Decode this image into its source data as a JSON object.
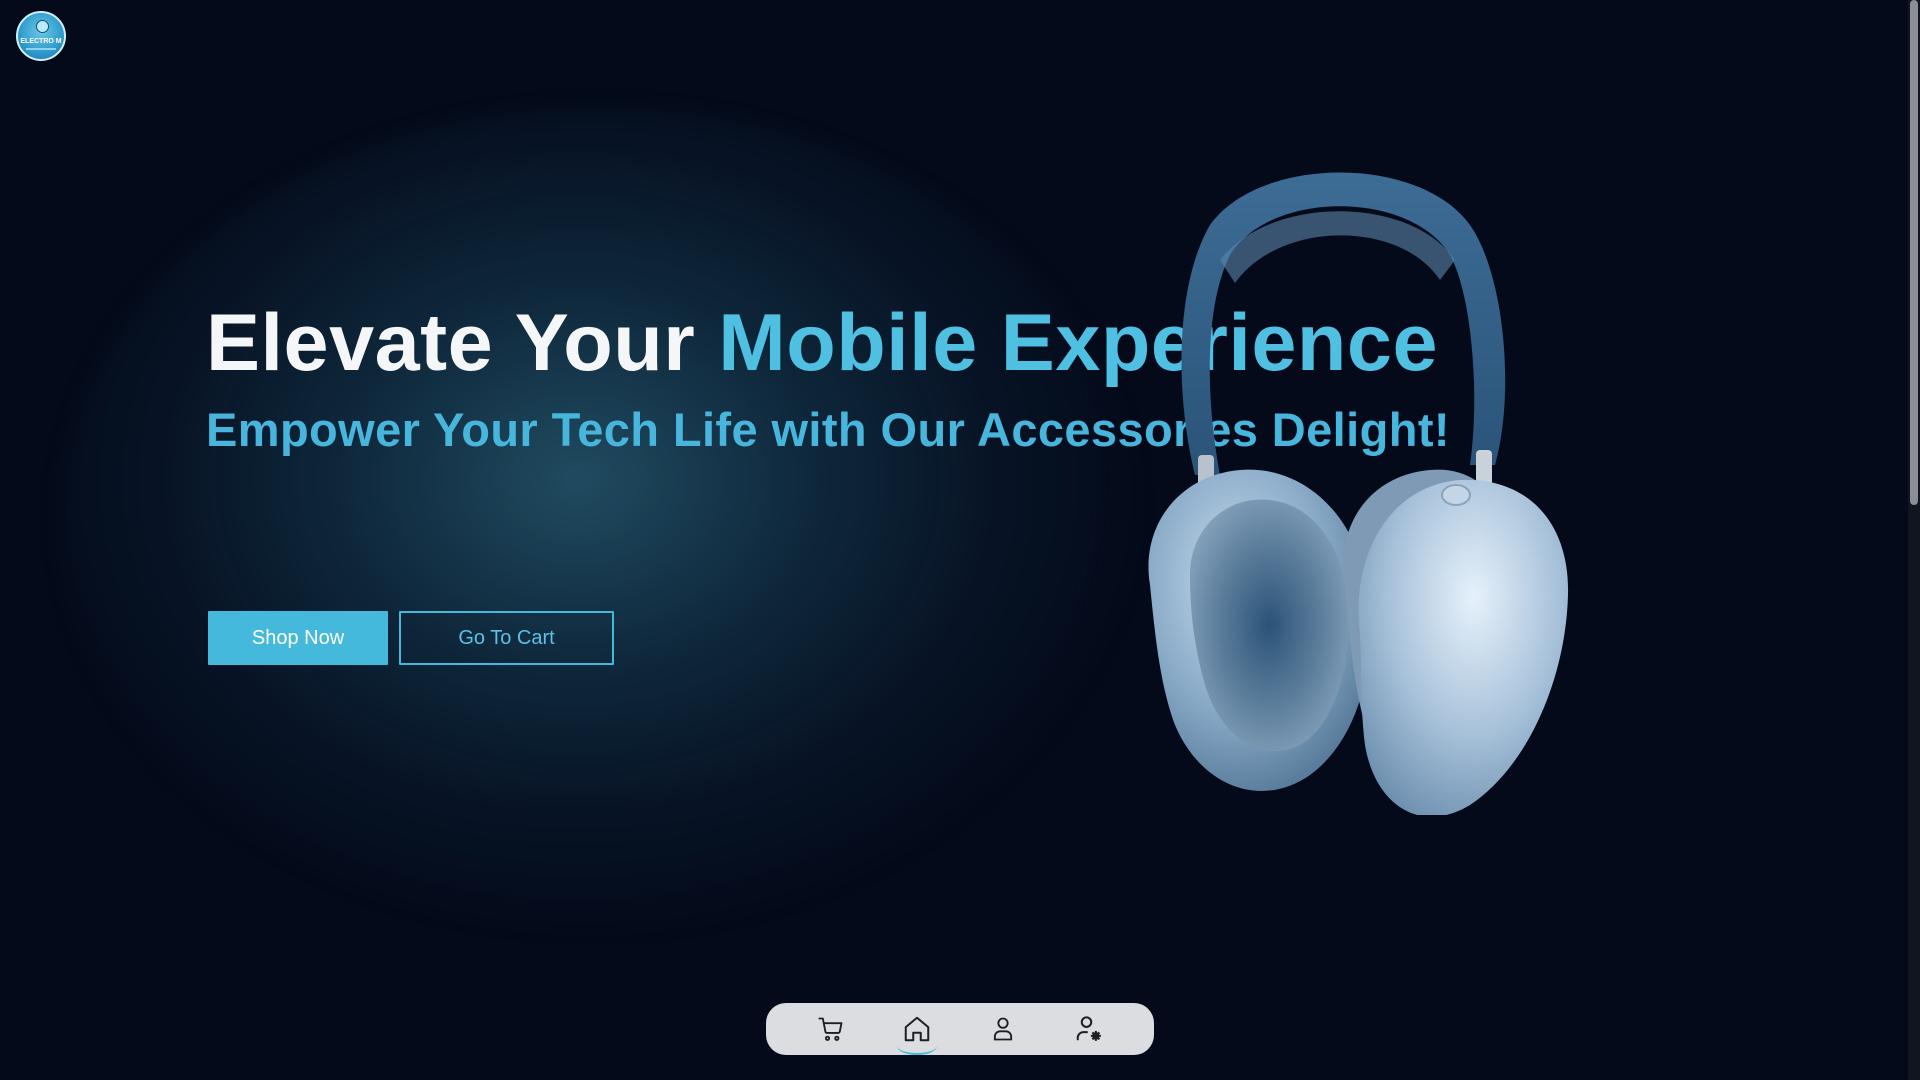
{
  "brand": {
    "logo_text": "ELECTRO M",
    "logo_icon": "globe-logo-icon"
  },
  "hero": {
    "headline_part1": "Elevate Your ",
    "headline_accent": "Mobile Experience",
    "subheadline": "Empower Your Tech Life with Our Accessories Delight!",
    "primary_button": "Shop Now",
    "secondary_button": "Go To Cart",
    "product_image": "headphones-image"
  },
  "dock": {
    "items": [
      {
        "icon": "cart-icon",
        "active": false
      },
      {
        "icon": "home-icon",
        "active": true
      },
      {
        "icon": "user-icon",
        "active": false
      },
      {
        "icon": "user-settings-icon",
        "active": false
      }
    ]
  },
  "colors": {
    "background": "#040a1a",
    "accent": "#45b9dc",
    "headline_white": "#f5f6f8",
    "dock_bg": "#dcdde0"
  }
}
